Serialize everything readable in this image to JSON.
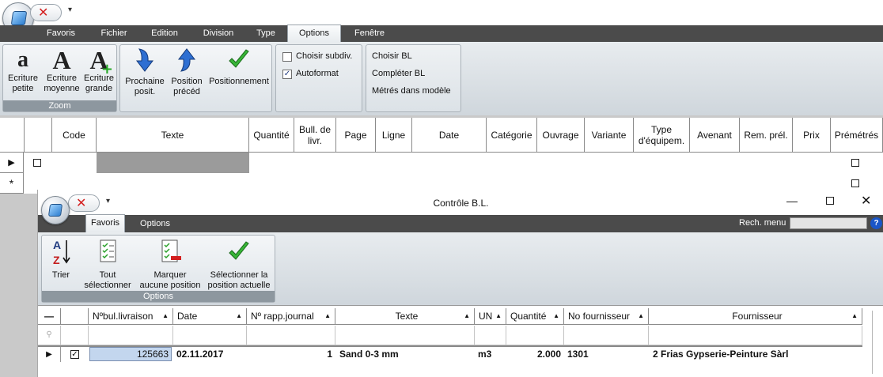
{
  "main": {
    "tabs": [
      "Favoris",
      "Fichier",
      "Edition",
      "Division",
      "Type",
      "Options",
      "Fenêtre"
    ],
    "active_tab": "Options",
    "zoom": {
      "caption": "Zoom",
      "buttons": [
        {
          "glyph": "a",
          "label_l1": "Ecriture",
          "label_l2": "petite"
        },
        {
          "glyph": "A",
          "label_l1": "Ecriture",
          "label_l2": "moyenne"
        },
        {
          "glyph": "A",
          "label_l1": "Ecriture",
          "label_l2": "grande"
        }
      ]
    },
    "nav": {
      "buttons": [
        {
          "label_l1": "Prochaine",
          "label_l2": "posit."
        },
        {
          "label_l1": "Position",
          "label_l2": "précéd"
        },
        {
          "label_l1": "Positionnement",
          "label_l2": ""
        }
      ]
    },
    "checks": [
      {
        "label": "Choisir subdiv.",
        "checked": false
      },
      {
        "label": "Autoformat",
        "checked": true
      }
    ],
    "bl_menu": [
      "Choisir BL",
      "Compléter BL",
      "Métrés dans modèle"
    ],
    "columns": [
      "Code",
      "Texte",
      "Quantité",
      "Bull. de livr.",
      "Page",
      "Ligne",
      "Date",
      "Catégorie",
      "Ouvrage",
      "Variante",
      "Type d'équipem.",
      "Avenant",
      "Rem. prél.",
      "Prix",
      "Prémétrés"
    ],
    "new_row_marker": "*"
  },
  "sub": {
    "title": "Contrôle B.L.",
    "tabs": [
      "Favoris",
      "Options"
    ],
    "active_tab": "Favoris",
    "search_label": "Rech. menu",
    "search_value": "",
    "group_caption": "Options",
    "buttons": [
      {
        "label_l1": "Trier",
        "label_l2": ""
      },
      {
        "label_l1": "Tout",
        "label_l2": "sélectionner"
      },
      {
        "label_l1": "Marquer",
        "label_l2": "aucune position"
      },
      {
        "label_l1": "Sélectionner la",
        "label_l2": "position actuelle"
      }
    ],
    "columns": [
      "Nºbul.livraison",
      "Date",
      "Nº rapp.journal",
      "Texte",
      "UN",
      "Quantité",
      "No fournisseur",
      "Fournisseur"
    ],
    "row": {
      "checked": true,
      "bulletin": "125663",
      "date": "02.11.2017",
      "rapp": "1",
      "texte": "Sand 0-3 mm",
      "un": "m3",
      "quantite": "2.000",
      "no_fournisseur": "1301",
      "fournisseur": "2 Frias Gypserie-Peinture Sàrl"
    }
  },
  "icons": [
    "app-orb",
    "close",
    "dropdown",
    "font-small",
    "font-medium",
    "font-large",
    "arrow-down",
    "arrow-up",
    "checkmark",
    "sort-az",
    "select-all",
    "mark-none",
    "select-current",
    "minimize",
    "maximize",
    "close-window",
    "help"
  ]
}
